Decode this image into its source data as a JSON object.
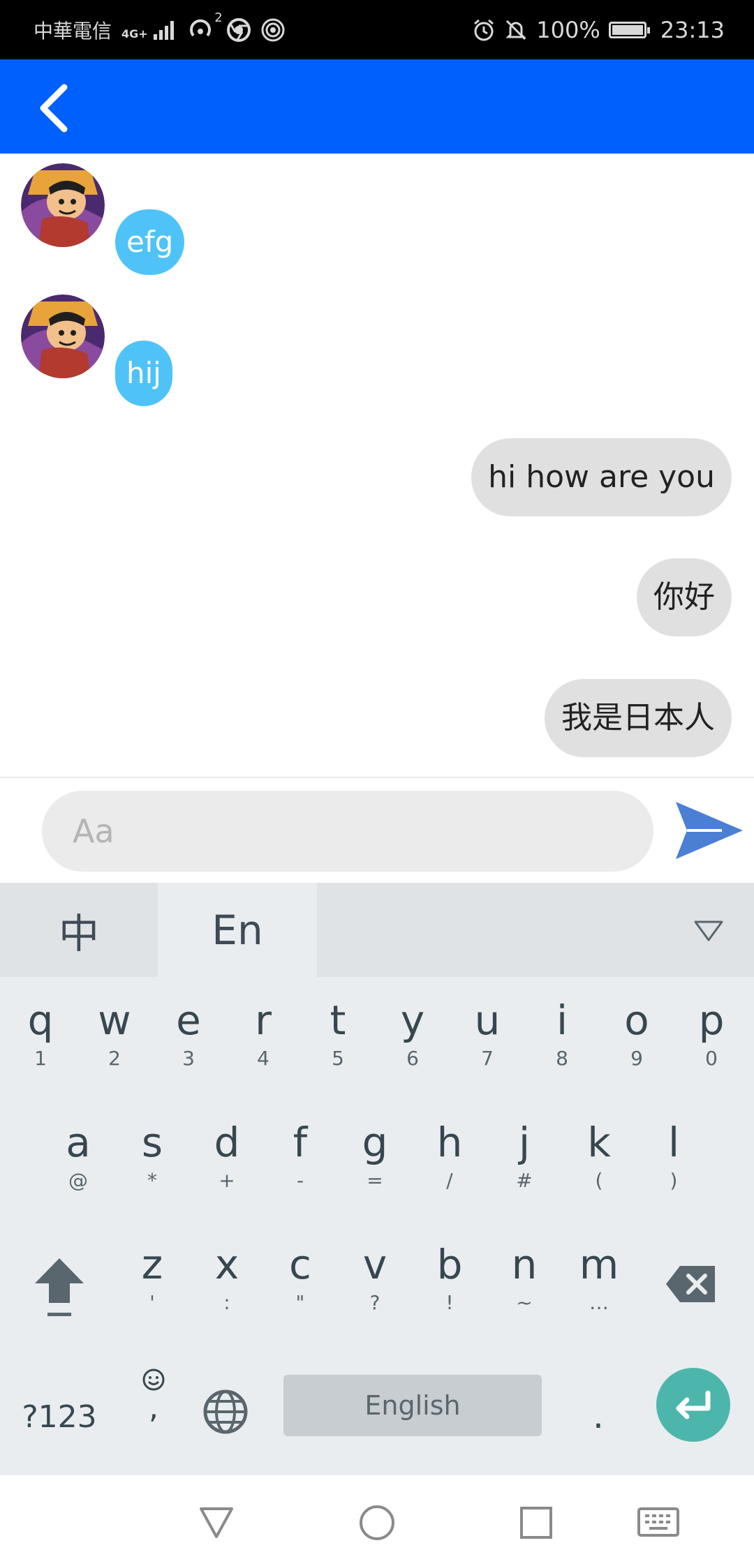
{
  "status_bar": {
    "carrier": "中華電信",
    "network": "4G+",
    "network_badge": "2",
    "battery": "100%",
    "time": "23:13",
    "icons": [
      "signal-icon",
      "hotspot-icon",
      "chrome-icon",
      "nfc-icon",
      "alarm-icon",
      "mute-icon",
      "battery-icon"
    ]
  },
  "app_bar": {
    "back_icon": "chevron-left-icon",
    "color": "#0060fb"
  },
  "messages": [
    {
      "direction": "incoming",
      "text": "efg",
      "avatar": "user-avatar"
    },
    {
      "direction": "incoming",
      "text": "hij",
      "avatar": "user-avatar"
    },
    {
      "direction": "outgoing",
      "text": "hi how are you"
    },
    {
      "direction": "outgoing",
      "text": "你好"
    },
    {
      "direction": "outgoing",
      "text": "我是日本人"
    }
  ],
  "composer": {
    "placeholder": "Aa",
    "value": "",
    "send_icon": "send-icon",
    "send_color": "#4a7fd4"
  },
  "keyboard": {
    "tabs": [
      {
        "label": "中",
        "active": false
      },
      {
        "label": "En",
        "active": true
      }
    ],
    "collapse_icon": "triangle-down-icon",
    "row1": [
      {
        "main": "q",
        "sub": "1"
      },
      {
        "main": "w",
        "sub": "2"
      },
      {
        "main": "e",
        "sub": "3"
      },
      {
        "main": "r",
        "sub": "4"
      },
      {
        "main": "t",
        "sub": "5"
      },
      {
        "main": "y",
        "sub": "6"
      },
      {
        "main": "u",
        "sub": "7"
      },
      {
        "main": "i",
        "sub": "8"
      },
      {
        "main": "o",
        "sub": "9"
      },
      {
        "main": "p",
        "sub": "0"
      }
    ],
    "row2": [
      {
        "main": "a",
        "sub": "@"
      },
      {
        "main": "s",
        "sub": "*"
      },
      {
        "main": "d",
        "sub": "+"
      },
      {
        "main": "f",
        "sub": "-"
      },
      {
        "main": "g",
        "sub": "="
      },
      {
        "main": "h",
        "sub": "/"
      },
      {
        "main": "j",
        "sub": "#"
      },
      {
        "main": "k",
        "sub": "("
      },
      {
        "main": "l",
        "sub": ")"
      }
    ],
    "row3": [
      {
        "main": "z",
        "sub": "'"
      },
      {
        "main": "x",
        "sub": ":"
      },
      {
        "main": "c",
        "sub": "\""
      },
      {
        "main": "v",
        "sub": "?"
      },
      {
        "main": "b",
        "sub": "!"
      },
      {
        "main": "n",
        "sub": "~"
      },
      {
        "main": "m",
        "sub": "…"
      }
    ],
    "symbols_label": "?123",
    "emoji_sub": ",",
    "space_label": "English",
    "period_label": ".",
    "enter_color": "#4db6ac"
  },
  "nav_bar": {
    "icons": [
      "back-triangle-icon",
      "home-circle-icon",
      "recents-square-icon",
      "keyboard-icon"
    ]
  }
}
